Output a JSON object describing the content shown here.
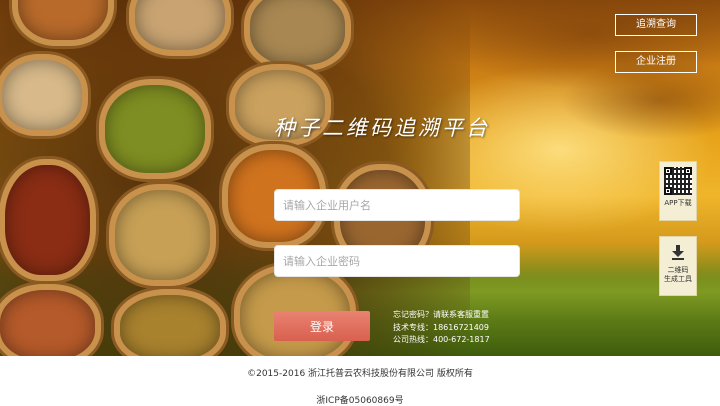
{
  "header": {
    "trace_query_label": "追溯查询",
    "company_register_label": "企业注册"
  },
  "hero": {
    "title": "种子二维码追溯平台"
  },
  "login": {
    "username_placeholder": "请输入企业用户名",
    "password_placeholder": "请输入企业密码",
    "username_value": "",
    "password_value": "",
    "submit_label": "登录",
    "help_lines": [
      "忘记密码？请联系客服重置",
      "技术专线：18616721409",
      "公司热线：400-672-1817"
    ]
  },
  "side": {
    "app_download_label": "APP下载",
    "qr_tool_label_line1": "二维码",
    "qr_tool_label_line2": "生成工具",
    "app_icon": "qr-code-icon",
    "tool_icon": "download-arrow-icon"
  },
  "footer": {
    "copyright": "©2015-2016 浙江托普云农科技股份有限公司 版权所有",
    "icp": "浙ICP备05060869号"
  },
  "colors": {
    "login_button": "#d9604e",
    "side_card_bg": "#f4eed4"
  }
}
